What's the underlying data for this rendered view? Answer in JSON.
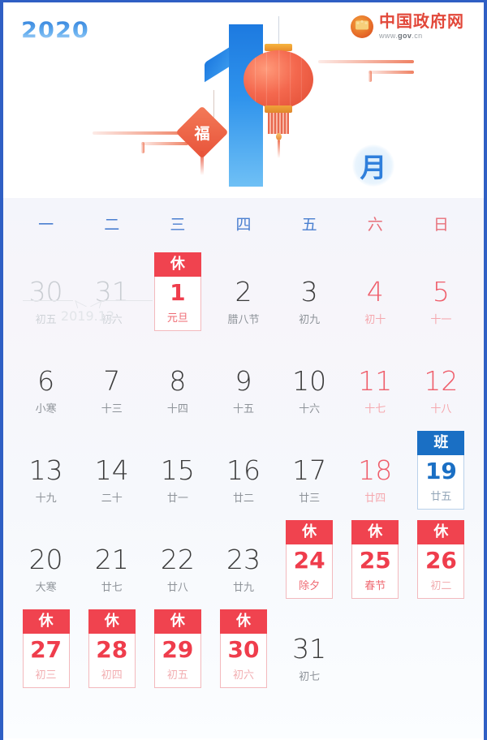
{
  "header": {
    "year_logo": "2020",
    "gov_name": "中国政府网",
    "gov_url_prefix": "www.",
    "gov_url_bold": "gov",
    "gov_url_suffix": ".cn",
    "month_numeral": "1",
    "month_label": "月",
    "fu_charm": "福"
  },
  "weekdays": [
    {
      "label": "一",
      "weekend": false
    },
    {
      "label": "二",
      "weekend": false
    },
    {
      "label": "三",
      "weekend": false
    },
    {
      "label": "四",
      "weekend": false
    },
    {
      "label": "五",
      "weekend": false
    },
    {
      "label": "六",
      "weekend": true
    },
    {
      "label": "日",
      "weekend": true
    }
  ],
  "prev_month_label": "2019.12",
  "colors": {
    "rest_badge": "#f0434f",
    "work_badge": "#1a6fc4",
    "weekend_text": "#ef5d6a",
    "weekday_header": "#4a7fd0",
    "border_blue": "#2f5fc4"
  },
  "badges": {
    "rest": "休",
    "work": "班"
  },
  "days": [
    {
      "num": "30",
      "lunar": "初五",
      "type": "other"
    },
    {
      "num": "31",
      "lunar": "初六",
      "type": "other"
    },
    {
      "num": "1",
      "lunar": "元旦",
      "type": "rest"
    },
    {
      "num": "2",
      "lunar": "腊八节",
      "type": "normal"
    },
    {
      "num": "3",
      "lunar": "初九",
      "type": "normal"
    },
    {
      "num": "4",
      "lunar": "初十",
      "type": "weekend"
    },
    {
      "num": "5",
      "lunar": "十一",
      "type": "weekend"
    },
    {
      "num": "6",
      "lunar": "小寒",
      "type": "normal"
    },
    {
      "num": "7",
      "lunar": "十三",
      "type": "normal"
    },
    {
      "num": "8",
      "lunar": "十四",
      "type": "normal"
    },
    {
      "num": "9",
      "lunar": "十五",
      "type": "normal"
    },
    {
      "num": "10",
      "lunar": "十六",
      "type": "normal"
    },
    {
      "num": "11",
      "lunar": "十七",
      "type": "weekend"
    },
    {
      "num": "12",
      "lunar": "十八",
      "type": "weekend"
    },
    {
      "num": "13",
      "lunar": "十九",
      "type": "normal"
    },
    {
      "num": "14",
      "lunar": "二十",
      "type": "normal"
    },
    {
      "num": "15",
      "lunar": "廿一",
      "type": "normal"
    },
    {
      "num": "16",
      "lunar": "廿二",
      "type": "normal"
    },
    {
      "num": "17",
      "lunar": "廿三",
      "type": "normal"
    },
    {
      "num": "18",
      "lunar": "廿四",
      "type": "weekend"
    },
    {
      "num": "19",
      "lunar": "廿五",
      "type": "work"
    },
    {
      "num": "20",
      "lunar": "大寒",
      "type": "normal"
    },
    {
      "num": "21",
      "lunar": "廿七",
      "type": "normal"
    },
    {
      "num": "22",
      "lunar": "廿八",
      "type": "normal"
    },
    {
      "num": "23",
      "lunar": "廿九",
      "type": "normal"
    },
    {
      "num": "24",
      "lunar": "除夕",
      "type": "rest"
    },
    {
      "num": "25",
      "lunar": "春节",
      "type": "rest"
    },
    {
      "num": "26",
      "lunar": "初二",
      "type": "rest",
      "lunar_mute": true
    },
    {
      "num": "27",
      "lunar": "初三",
      "type": "rest",
      "lunar_mute": true
    },
    {
      "num": "28",
      "lunar": "初四",
      "type": "rest",
      "lunar_mute": true
    },
    {
      "num": "29",
      "lunar": "初五",
      "type": "rest",
      "lunar_mute": true
    },
    {
      "num": "30",
      "lunar": "初六",
      "type": "rest",
      "lunar_mute": true
    },
    {
      "num": "31",
      "lunar": "初七",
      "type": "normal"
    },
    {
      "num": "",
      "lunar": "",
      "type": "empty"
    },
    {
      "num": "",
      "lunar": "",
      "type": "empty"
    }
  ]
}
